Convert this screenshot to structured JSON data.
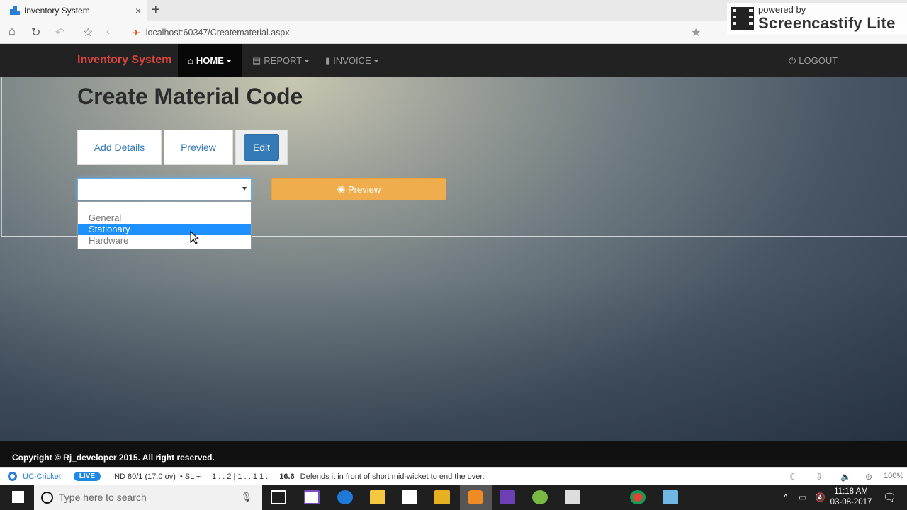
{
  "browser": {
    "tab_title": "Inventory System",
    "tab_close": "×",
    "new_tab": "+",
    "url": "localhost:60347/Creatematerial.aspx"
  },
  "watermark": {
    "line1": "powered by",
    "line2": "Screencastify Lite"
  },
  "navbar": {
    "brand": "Inventory System",
    "home": "HOME",
    "report": "REPORT",
    "invoice": "INVOICE",
    "logout": "LOGOUT"
  },
  "page": {
    "title": "Create Material Code",
    "tabs": {
      "add": "Add Details",
      "preview": "Preview",
      "edit": "Edit"
    },
    "select_value": "",
    "options": [
      "General",
      "Stationary",
      "Hardware"
    ],
    "selected_option": "Stationary",
    "preview_button": "Preview"
  },
  "footer": {
    "copyright": "Copyright © Rj_developer 2015. All right reserved."
  },
  "ticker": {
    "app": "UC-Cricket",
    "live": "LIVE",
    "score": "IND 80/1 (17.0 ov)",
    "vs": "• SL ÷",
    "overs": "1 . . 2 | 1 . . 1 1 .",
    "ball": "16.6",
    "commentary": "Defends it in front of short mid-wicket to end the over.",
    "zoom": "100%"
  },
  "taskbar": {
    "search_placeholder": "Type here to search",
    "time": "11:18 AM",
    "date": "03-08-2017"
  },
  "colors": {
    "brand": "#d9453c",
    "primary": "#337ab7",
    "warning": "#f0ad4e",
    "navbar": "#222222"
  }
}
